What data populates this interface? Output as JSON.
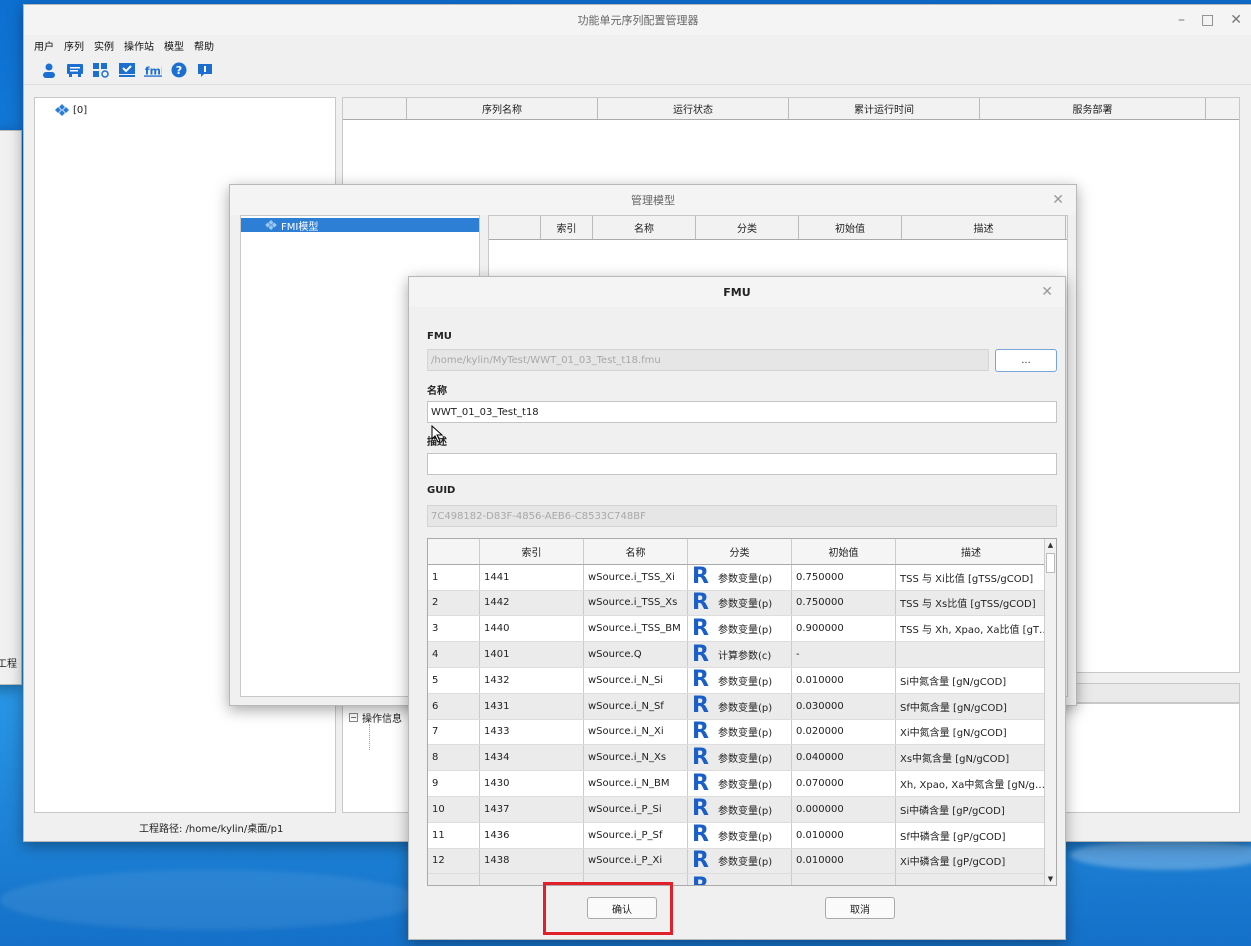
{
  "main_window": {
    "title": "功能单元序列配置管理器",
    "controls": [
      "–",
      "□",
      "✕"
    ],
    "menu": [
      "用户",
      "序列",
      "实例",
      "操作站",
      "模型",
      "帮助"
    ],
    "toolbar_icons": [
      "user-icon",
      "sequence-icon",
      "instance-icon",
      "station-icon",
      "fmi-icon",
      "help-icon",
      "info-icon"
    ],
    "tree_root": "[0]",
    "columns": [
      "",
      "序列名称",
      "运行状态",
      "累计运行时间",
      "服务部署"
    ],
    "log_root": "操作信息",
    "status_path": "工程路径: /home/kylin/桌面/p1"
  },
  "side_fragment": "工程",
  "manager_dialog": {
    "title": "管理模型",
    "tree_item": "FMI模型",
    "columns": [
      "",
      "索引",
      "名称",
      "分类",
      "初始值",
      "描述"
    ]
  },
  "fmu_dialog": {
    "title": "FMU",
    "fmu_label": "FMU",
    "fmu_path": "/home/kylin/MyTest/WWT_01_03_Test_t18.fmu",
    "browse_label": "...",
    "name_label": "名称",
    "name_value": "WWT_01_03_Test_t18",
    "desc_label": "描述",
    "desc_value": "",
    "guid_label": "GUID",
    "guid_value": "7C498182-D83F-4856-AEB6-C8533C748BF",
    "columns": [
      "",
      "索引",
      "名称",
      "分类",
      "初始值",
      "描述"
    ],
    "rows": [
      [
        "1",
        "1441",
        "wSource.i_TSS_Xi",
        "参数变量(p)",
        "0.750000",
        "TSS 与 Xi比值 [gTSS/gCOD]"
      ],
      [
        "2",
        "1442",
        "wSource.i_TSS_Xs",
        "参数变量(p)",
        "0.750000",
        "TSS 与 Xs比值 [gTSS/gCOD]"
      ],
      [
        "3",
        "1440",
        "wSource.i_TSS_BM",
        "参数变量(p)",
        "0.900000",
        "TSS 与 Xh, Xpao, Xa比值 [gT…"
      ],
      [
        "4",
        "1401",
        "wSource.Q",
        "计算参数(c)",
        "-",
        ""
      ],
      [
        "5",
        "1432",
        "wSource.i_N_Si",
        "参数变量(p)",
        "0.010000",
        "Si中氮含量 [gN/gCOD]"
      ],
      [
        "6",
        "1431",
        "wSource.i_N_Sf",
        "参数变量(p)",
        "0.030000",
        "Sf中氮含量 [gN/gCOD]"
      ],
      [
        "7",
        "1433",
        "wSource.i_N_Xi",
        "参数变量(p)",
        "0.020000",
        "Xi中氮含量 [gN/gCOD]"
      ],
      [
        "8",
        "1434",
        "wSource.i_N_Xs",
        "参数变量(p)",
        "0.040000",
        "Xs中氮含量 [gN/gCOD]"
      ],
      [
        "9",
        "1430",
        "wSource.i_N_BM",
        "参数变量(p)",
        "0.070000",
        "Xh, Xpao, Xa中氮含量 [gN/g…"
      ],
      [
        "10",
        "1437",
        "wSource.i_P_Si",
        "参数变量(p)",
        "0.000000",
        "Si中磷含量 [gP/gCOD]"
      ],
      [
        "11",
        "1436",
        "wSource.i_P_Sf",
        "参数变量(p)",
        "0.010000",
        "Sf中磷含量 [gP/gCOD]"
      ],
      [
        "12",
        "1438",
        "wSource.i_P_Xi",
        "参数变量(p)",
        "0.010000",
        "Xi中磷含量 [gP/gCOD]"
      ]
    ],
    "confirm_label": "确认",
    "cancel_label": "取消"
  },
  "colors": {
    "selection": "#2d7fd6",
    "icon_blue": "#1a5fc8",
    "highlight": "#e0202a"
  }
}
